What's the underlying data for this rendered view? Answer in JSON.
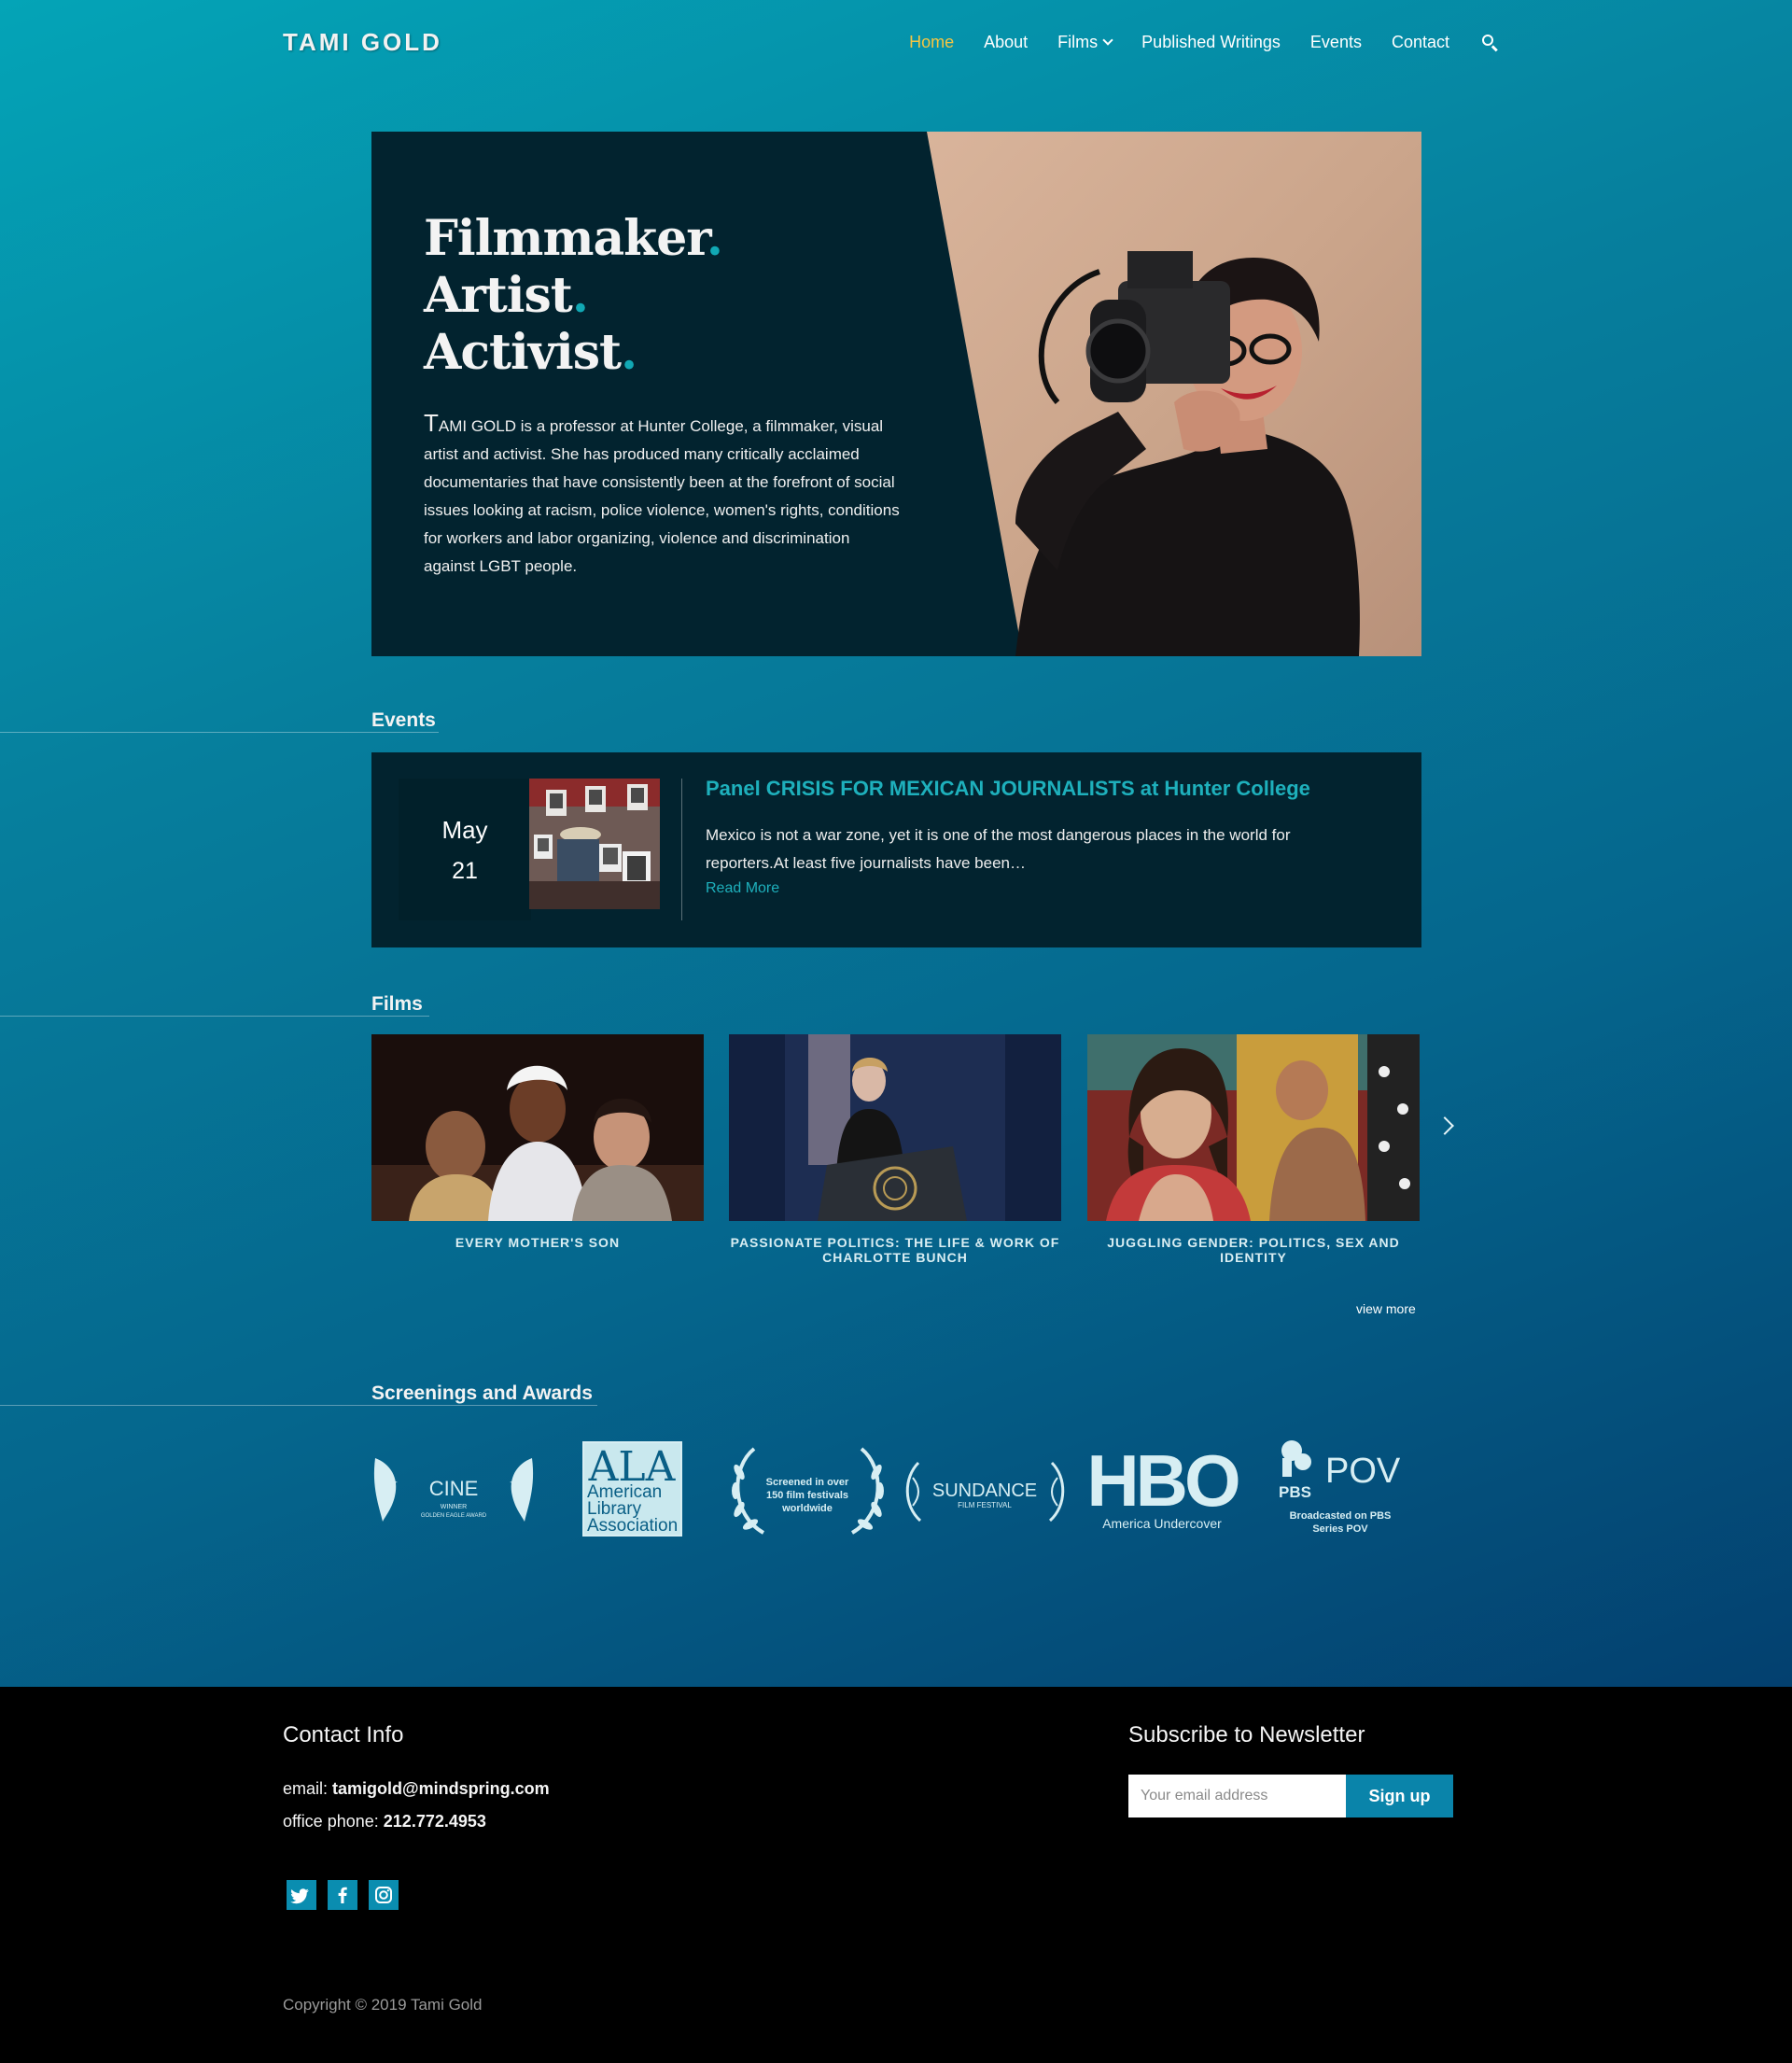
{
  "header": {
    "logo": "TAMI GOLD",
    "nav": [
      {
        "label": "Home",
        "active": true
      },
      {
        "label": "About"
      },
      {
        "label": "Films",
        "has_dropdown": true
      },
      {
        "label": "Published Writings"
      },
      {
        "label": "Events"
      },
      {
        "label": "Contact"
      }
    ],
    "search_icon": "search-icon"
  },
  "hero": {
    "headline_1": "Filmmaker",
    "headline_2": "Artist",
    "headline_3": "Activist",
    "dot": ".",
    "dropcap": "T",
    "body_rest": "AMI GOLD is a professor at Hunter College, a filmmaker, visual artist and activist. She has produced many critically acclaimed documentaries that have consistently been at the forefront of social issues looking at racism, police violence, women's rights, conditions for workers and labor organizing, violence and discrimination against LGBT people."
  },
  "events": {
    "section_title": "Events",
    "items": [
      {
        "month": "May",
        "day": "21",
        "title": "Panel CRISIS FOR MEXICAN JOURNALISTS at Hunter College",
        "description": "Mexico is not a war zone, yet it is one of the most dangerous places in the world for reporters.At least five journalists have been…",
        "read_more": "Read More"
      }
    ]
  },
  "films": {
    "section_title": "Films",
    "items": [
      {
        "title": "EVERY MOTHER'S SON"
      },
      {
        "title": "PASSIONATE POLITICS: THE LIFE & WORK OF CHARLOTTE BUNCH"
      },
      {
        "title": "JUGGLING GENDER: POLITICS, SEX AND IDENTITY"
      }
    ],
    "view_more": "view more",
    "next_icon": "chevron-right-icon"
  },
  "awards": {
    "section_title": "Screenings and Awards",
    "logos": [
      {
        "name": "cine-golden-eagle-logo",
        "main": "CINE",
        "sub1": "WINNER",
        "sub2": "GOLDEN EAGLE AWARD"
      },
      {
        "name": "ala-logo",
        "main": "ALA",
        "lines": [
          "American",
          "Library",
          "Association"
        ]
      },
      {
        "name": "festivals-laurel-logo",
        "lines": [
          "Screened in over",
          "150 film festivals",
          "worldwide"
        ]
      },
      {
        "name": "sundance-logo",
        "main": "SUNDANCE",
        "sub": "FILM FESTIVAL"
      },
      {
        "name": "hbo-logo",
        "main": "HBO",
        "sub": "America Undercover"
      },
      {
        "name": "pbs-pov-logo",
        "pbs": "PBS",
        "main": "POV",
        "lines": [
          "Broadcasted on PBS",
          "Series POV"
        ]
      }
    ]
  },
  "footer": {
    "contact_title": "Contact Info",
    "email_label": "email:",
    "email": "tamigold@mindspring.com",
    "phone_label": "office phone:",
    "phone": "212.772.4953",
    "social": [
      "twitter-icon",
      "facebook-icon",
      "instagram-icon"
    ],
    "newsletter_title": "Subscribe to Newsletter",
    "email_placeholder": "Your email address",
    "signup_label": "Sign up",
    "copyright": "Copyright © 2019 Tami Gold"
  },
  "colors": {
    "accent": "#11a8b4",
    "nav_active": "#f5c542",
    "card_bg": "#02232f",
    "button": "#0a84aa"
  }
}
